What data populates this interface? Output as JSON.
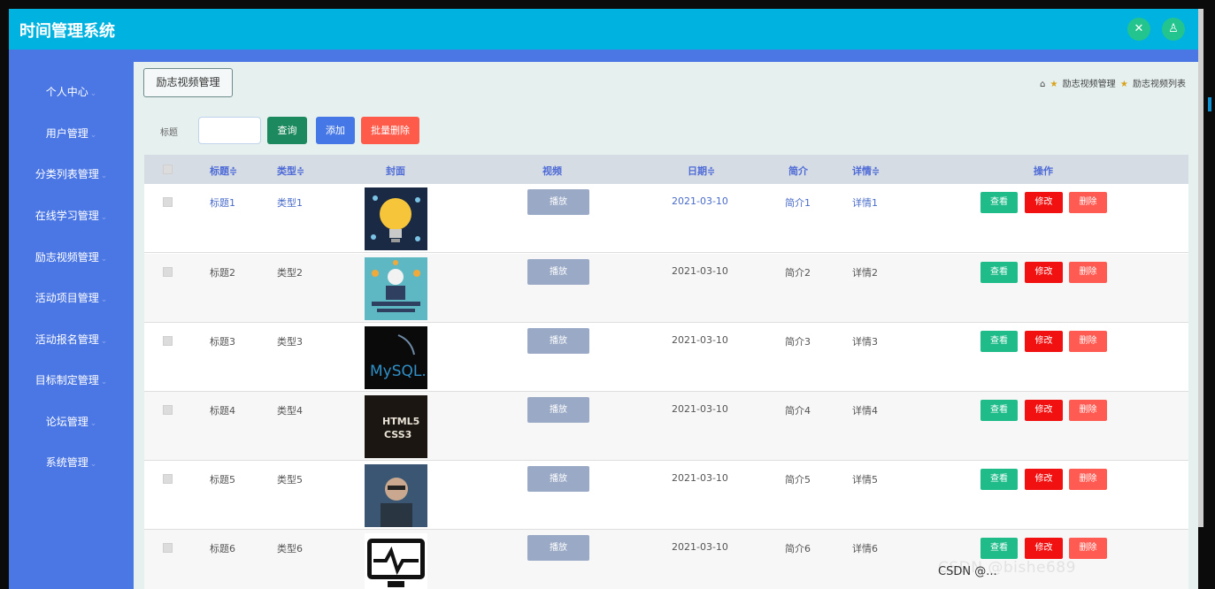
{
  "app": {
    "title": "时间管理系统",
    "header_buttons": [
      {
        "icon": "fullscreen-icon",
        "glyph": "✕"
      },
      {
        "icon": "user-icon",
        "glyph": "♙"
      }
    ],
    "colors": {
      "header": "#00b2df",
      "sidebar": "#4b77e4",
      "query_button": "#1c8a5e",
      "add_button": "#4677e6",
      "batch_delete_button": "#ff5b4b",
      "view_button": "#1fbc8a",
      "edit_button": "#f21111",
      "delete_button": "#ff5b52"
    }
  },
  "sidebar": {
    "items": [
      {
        "label": "个人中心",
        "arrow": "⌄"
      },
      {
        "label": "用户管理",
        "arrow": "⌄"
      },
      {
        "label": "分类列表管理",
        "arrow": "⌄"
      },
      {
        "label": "在线学习管理",
        "arrow": "⌄"
      },
      {
        "label": "励志视频管理",
        "arrow": "⌄"
      },
      {
        "label": "活动项目管理",
        "arrow": "⌄"
      },
      {
        "label": "活动报名管理",
        "arrow": "⌄"
      },
      {
        "label": "目标制定管理",
        "arrow": "⌄"
      },
      {
        "label": "论坛管理",
        "arrow": "⌄"
      },
      {
        "label": "系统管理",
        "arrow": "⌄"
      }
    ]
  },
  "page": {
    "tag": "励志视频管理",
    "breadcrumb": {
      "home_icon": "⌂",
      "star": "★",
      "level1": "励志视频管理",
      "level2": "励志视频列表"
    }
  },
  "search": {
    "label": "标题",
    "placeholder": "",
    "query_label": "查询",
    "add_label": "添加",
    "batch_delete_label": "批量删除"
  },
  "table": {
    "columns": {
      "title": "标题≑",
      "type": "类型≑",
      "cover": "封面",
      "video": "视频",
      "date": "日期≑",
      "intro": "简介",
      "detail": "详情≑",
      "ops": "操作"
    },
    "rows": [
      {
        "title": "标题1",
        "type": "类型1",
        "cover": "lightbulb-cover",
        "play": "播放",
        "date": "2021-03-10",
        "intro": "简介1",
        "detail": "详情1",
        "view": "查看",
        "edit": "修改",
        "del": "删除"
      },
      {
        "title": "标题2",
        "type": "类型2",
        "cover": "circuit-cover",
        "play": "播放",
        "date": "2021-03-10",
        "intro": "简介2",
        "detail": "详情2",
        "view": "查看",
        "edit": "修改",
        "del": "删除"
      },
      {
        "title": "标题3",
        "type": "类型3",
        "cover": "mysql-cover",
        "play": "播放",
        "date": "2021-03-10",
        "intro": "简介3",
        "detail": "详情3",
        "view": "查看",
        "edit": "修改",
        "del": "删除",
        "cover_text": "MySQL."
      },
      {
        "title": "标题4",
        "type": "类型4",
        "cover": "html5-css3-cover",
        "play": "播放",
        "date": "2021-03-10",
        "intro": "简介4",
        "detail": "详情4",
        "view": "查看",
        "edit": "修改",
        "del": "删除",
        "cover_text": "HTML5",
        "cover_text2": "CSS3"
      },
      {
        "title": "标题5",
        "type": "类型5",
        "cover": "person-cover",
        "play": "播放",
        "date": "2021-03-10",
        "intro": "简介5",
        "detail": "详情5",
        "view": "查看",
        "edit": "修改",
        "del": "删除"
      },
      {
        "title": "标题6",
        "type": "类型6",
        "cover": "monitor-cover",
        "play": "播放",
        "date": "2021-03-10",
        "intro": "简介6",
        "detail": "详情6",
        "view": "查看",
        "edit": "修改",
        "del": "删除"
      }
    ]
  },
  "watermark": {
    "text": "CSDN @bishe689",
    "small": "CSDN @..."
  }
}
